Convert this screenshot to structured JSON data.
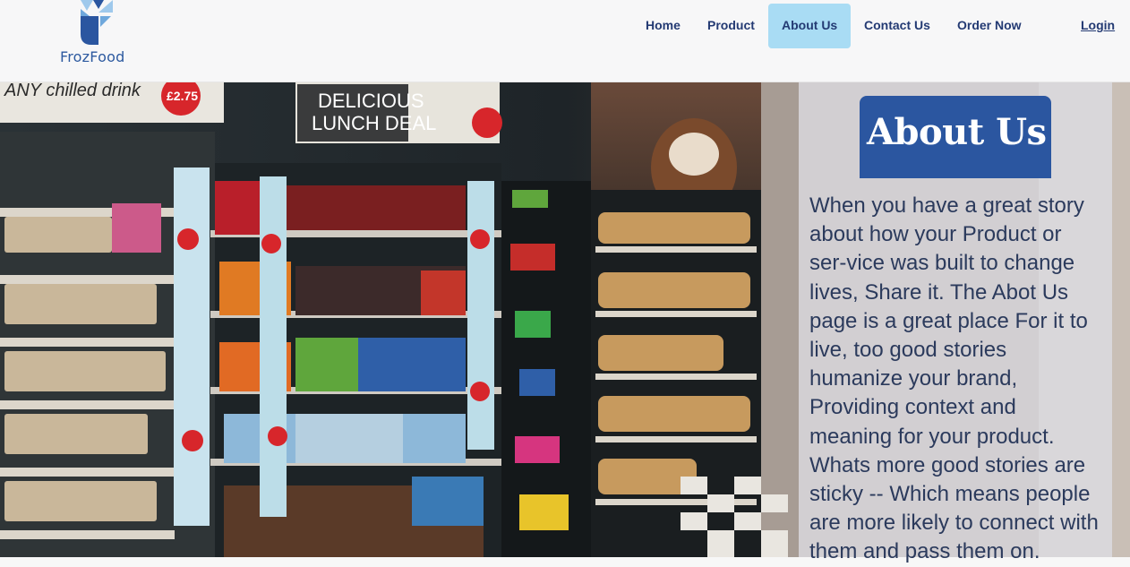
{
  "brand": {
    "name": "FrozFood"
  },
  "nav": {
    "home": "Home",
    "product": "Product",
    "about": "About Us",
    "contact": "Contact Us",
    "order": "Order Now",
    "login": "Login",
    "active_item": "About Us"
  },
  "colors": {
    "brand_blue": "#2b56a0",
    "nav_text": "#233a73",
    "active_bg": "#a9dcf4"
  },
  "hero": {
    "image_description": "store-shelves-photo",
    "sign_1": "DELICIOUS",
    "sign_2": "LUNCH DEAL",
    "sign_chilled": "ANY chilled drink",
    "price": "£2.75"
  },
  "about": {
    "title": "About Us",
    "body": "When you have a great story about how your Product or ser-vice was built to change lives, Share it. The Abot Us page is a great place For it to live, too good stories humanize your brand, Providing context and meaning for your product. Whats more good stories are sticky -- Which means people are more likely to connect with them and pass them on."
  }
}
